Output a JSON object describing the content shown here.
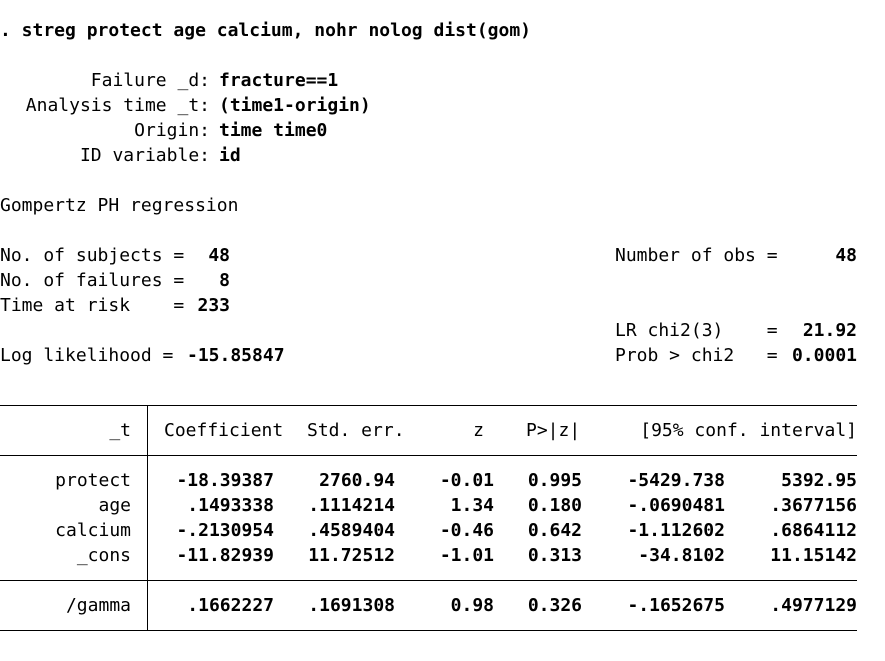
{
  "command": ". streg protect age calcium, nohr nolog dist(gom)",
  "settings": [
    {
      "label": "Failure _d:",
      "value": "fracture==1"
    },
    {
      "label": "Analysis time _t:",
      "value": "(time1-origin)"
    },
    {
      "label": "Origin:",
      "value": "time time0"
    },
    {
      "label": "ID variable:",
      "value": "id"
    }
  ],
  "model_title": "Gompertz PH regression",
  "stats_left": {
    "subjects_label": "No. of subjects =",
    "subjects_value": "48",
    "failures_label": "No. of failures =",
    "failures_value": "8",
    "risk_label": "Time at risk    =",
    "risk_value": "233",
    "loglik_label": "Log likelihood =",
    "loglik_value": "-15.85847"
  },
  "stats_right": {
    "nobs_label": "Number of obs =",
    "nobs_value": "48",
    "lr_label": "LR chi2(3)    =",
    "lr_value": "21.92",
    "prob_label": "Prob > chi2   =",
    "prob_value": "0.0001"
  },
  "table": {
    "headers": [
      "_t",
      "Coefficient",
      "Std. err.",
      "z",
      "P>|z|",
      "[95% conf. interval]"
    ],
    "rows": [
      {
        "var": "protect",
        "coef": "-18.39387",
        "se": "2760.94",
        "z": "-0.01",
        "p": "0.995",
        "lo": "-5429.738",
        "hi": "5392.95"
      },
      {
        "var": "age",
        "coef": ".1493338",
        "se": ".1114214",
        "z": "1.34",
        "p": "0.180",
        "lo": "-.0690481",
        "hi": ".3677156"
      },
      {
        "var": "calcium",
        "coef": "-.2130954",
        "se": ".4589404",
        "z": "-0.46",
        "p": "0.642",
        "lo": "-1.112602",
        "hi": ".6864112"
      },
      {
        "var": "_cons",
        "coef": "-11.82939",
        "se": "11.72512",
        "z": "-1.01",
        "p": "0.313",
        "lo": "-34.8102",
        "hi": "11.15142"
      }
    ],
    "aux": {
      "var": "/gamma",
      "coef": ".1662227",
      "se": ".1691308",
      "z": "0.98",
      "p": "0.326",
      "lo": "-.1652675",
      "hi": ".4977129"
    }
  }
}
